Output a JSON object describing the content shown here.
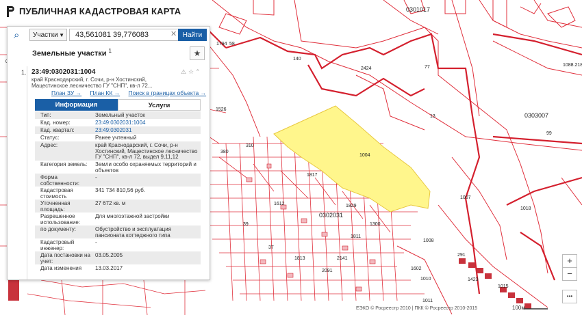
{
  "header": {
    "title": "ПУБЛИЧНАЯ КАДАСТРОВАЯ КАРТА",
    "logo_icon": "rosreestr-logo-icon"
  },
  "search": {
    "type_label": "Участки",
    "value": "43,561081 39,776083",
    "find_label": "Найти"
  },
  "section": {
    "title": "Земельные участки",
    "count": "1"
  },
  "result": {
    "index": "1.",
    "cadastral_number": "23:49:0302031:1004",
    "address": "край Краснодарский, г. Сочи, р-н Хостинский, Мацестинское лесничество ГУ \"СНП\", кв-л 72...",
    "links": {
      "plan_zu": "План ЗУ →",
      "plan_kk": "План КК →",
      "search_bounds": "Поиск в границах объекта →"
    }
  },
  "tabs": {
    "info": "Информация",
    "services": "Услуги"
  },
  "attributes": [
    {
      "key": "Тип:",
      "value": "Земельный участок",
      "link": false,
      "h": 11
    },
    {
      "key": "Кад. номер:",
      "value": "23:49:0302031:1004",
      "link": true,
      "h": 11
    },
    {
      "key": "Кад. квартал:",
      "value": "23:49:0302031",
      "link": true,
      "h": 11
    },
    {
      "key": "Статус:",
      "value": "Ранее учтенный",
      "link": false,
      "h": 11
    },
    {
      "key": "Адрес:",
      "value": "край Краснодарский, г. Сочи, р-н Хостинский, Мацестинское лесничество ГУ \"СНП\", кв-л 72, выдел 9,11,12",
      "link": false,
      "h": 28
    },
    {
      "key": "Категория земель:",
      "value": "Земли особо охраняемых территорий и объектов",
      "link": false,
      "h": 19
    },
    {
      "key": "Форма собственности:",
      "value": "-",
      "link": false,
      "h": 19
    },
    {
      "key": "Кадастровая стоимость",
      "value": "341 734 810,56 руб.",
      "link": false,
      "h": 19
    },
    {
      "key": "Уточненная площадь:",
      "value": "27 672 кв. м",
      "link": false,
      "h": 19
    },
    {
      "key": "Разрешенное использование:",
      "value": "Для многоэтажной застройки",
      "link": false,
      "h": 19
    },
    {
      "key": "по документу:",
      "value": "Обустройство и эксплуатация пансионата коттеджного типа",
      "link": false,
      "h": 19
    },
    {
      "key": "Кадастровый инженер:",
      "value": "-",
      "link": false,
      "h": 19
    },
    {
      "key": "Дата постановки на учет:",
      "value": "03.05.2005",
      "link": false,
      "h": 19
    },
    {
      "key": "Дата изменения",
      "value": "13.03.2017",
      "link": false,
      "h": 11
    }
  ],
  "map": {
    "labels": [
      "0301017",
      "0303007",
      "0302031",
      "1004",
      "2424",
      "77",
      "13",
      "99",
      "1007",
      "1018",
      "1008",
      "1088.218",
      "140",
      "1794",
      "58",
      "1526",
      "310",
      "380",
      "1817",
      "1612",
      "1829",
      "1010",
      "1423",
      "1011",
      "1015",
      "1602",
      "291",
      "39",
      "1300",
      "2091",
      "060",
      "1813",
      "2141",
      "37",
      "1811"
    ],
    "attribution": "ЕЭКО © Росреестр 2010 | ПКК © Росреестр 2010-2015",
    "scale": "100м",
    "colors": {
      "parcel_line": "#e0303c",
      "selected_fill": "#fff68c",
      "accent": "#1a5fa6"
    }
  },
  "controls": {
    "zoom_in": "+",
    "zoom_out": "−",
    "more": "•••"
  }
}
